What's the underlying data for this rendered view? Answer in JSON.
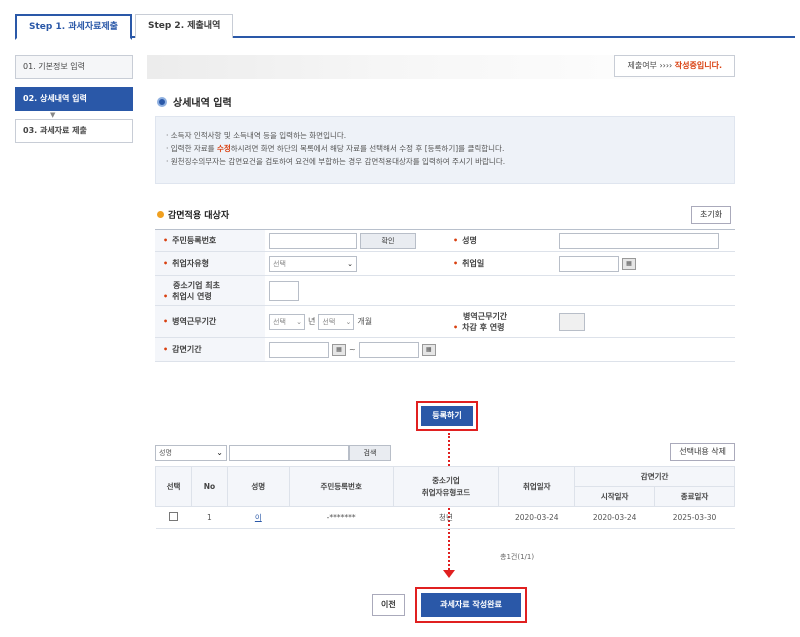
{
  "tabs": [
    {
      "label": "Step 1. 과세자료제출",
      "active": true
    },
    {
      "label": "Step 2. 제출내역",
      "active": false
    }
  ],
  "sidebar": {
    "items": [
      {
        "label": "01. 기본정보 입력"
      },
      {
        "label": "02. 상세내역 입력"
      },
      {
        "label": "03. 과세자료 제출"
      }
    ]
  },
  "status": {
    "prefix": "제출여부 ›››› ",
    "value": "작성중입니다."
  },
  "section_title": "상세내역 입력",
  "info": {
    "line1": "· 소득자 인적사항 및 소득내역 등을 입력하는 화면입니다.",
    "line2a": "· 입력한 자료를 ",
    "line2b": "수정",
    "line2c": "하시려면 화면 하단의 목록에서 해당 자료를 선택해서 수정 후 [등록하기]를 클릭합니다.",
    "line3": "· 원천징수의무자는 감면요건을 검토하여 요건에 부합하는 경우 감면적용대상자를 입력하여 주시기 바랍니다."
  },
  "subsection_title": "감면적용 대상자",
  "reset_label": "초기화",
  "form": {
    "rrn_label": "주민등록번호",
    "confirm_label": "확인",
    "name_label": "성명",
    "emp_type_label": "취업자유형",
    "emp_type_value": "선택",
    "emp_date_label": "취업일",
    "sme_label1": "중소기업 최초",
    "sme_label2": "취업시 연령",
    "military_label": "병역근무기간",
    "military_sel1": "선택",
    "year_label": "년",
    "military_sel2": "선택",
    "month_label": "개월",
    "military_deduct_label1": "병역근무기간",
    "military_deduct_label2": "차감 후 연령",
    "exempt_period_label": "감면기간",
    "tilde": "~",
    "cal_icon_text": "▦"
  },
  "register_label": "등록하기",
  "search": {
    "field_value": "성명",
    "search_label": "검색",
    "delete_label": "선택내용 삭제"
  },
  "table": {
    "headers": {
      "select": "선택",
      "no": "No",
      "name": "성명",
      "rrn": "주민등록번호",
      "sme1": "중소기업",
      "sme2": "취업자유형코드",
      "emp_date": "취업일자",
      "exempt": "감면기간",
      "start": "시작일자",
      "end": "종료일자"
    },
    "rows": [
      {
        "no": "1",
        "name": "이",
        "rrn": "-*******",
        "code": "청년",
        "emp_date": "2020-03-24",
        "start": "2020-03-24",
        "end": "2025-03-30"
      }
    ]
  },
  "total": "총1건(1/1)",
  "prev_label": "이전",
  "done_label": "과세자료 작성완료"
}
